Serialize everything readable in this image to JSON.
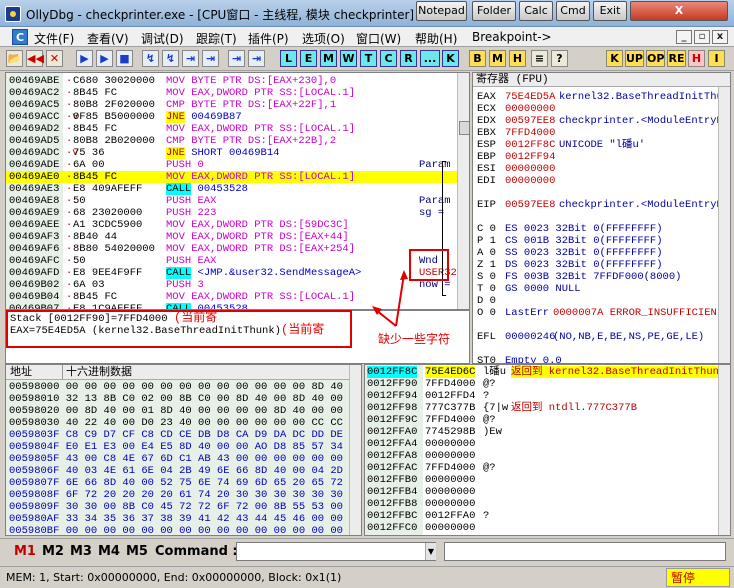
{
  "titlebar": {
    "title": "OllyDbg - checkprinter.exe - [CPU窗口 - 主线程, 模块 checkprinter]",
    "buttons": [
      "Notepad",
      "Folder",
      "Calc",
      "Cmd",
      "Exit"
    ],
    "close": "X"
  },
  "menu": {
    "icon_label": "C",
    "items": [
      "文件(F)",
      "查看(V)",
      "调试(D)",
      "跟踪(T)",
      "插件(P)",
      "选项(O)",
      "窗口(W)",
      "帮助(H)",
      "Breakpoint->"
    ]
  },
  "toolbar": {
    "debug_buttons": [
      "▶",
      "▶",
      "■",
      "↯",
      "↯",
      "⇥",
      "⇥",
      "⇥",
      "⇥"
    ],
    "window_letters": [
      "L",
      "E",
      "M",
      "W",
      "T",
      "C",
      "R",
      "...",
      "K"
    ],
    "extra_letters": [
      "B",
      "M",
      "H"
    ],
    "right_letters": [
      "K",
      "UP",
      "OP",
      "RE",
      "H",
      "I"
    ]
  },
  "disasm": {
    "rows": [
      {
        "addr": "00469ABE",
        "mark": "·",
        "bytes": "C680 30020000",
        "asm": [
          [
            "mov",
            "MOV BYTE PTR DS:[EAX+230],0"
          ]
        ],
        "cmt": ""
      },
      {
        "addr": "00469AC2",
        "mark": "·",
        "bytes": "8B45 FC",
        "asm": [
          [
            "mov",
            "MOV EAX,DWORD PTR SS:[LOCAL.1]"
          ]
        ],
        "cmt": ""
      },
      {
        "addr": "00469AC5",
        "mark": "·",
        "bytes": "80B8 2F020000",
        "asm": [
          [
            "cmp",
            "CMP BYTE PTR DS:[EAX+22F],1"
          ]
        ],
        "cmt": ""
      },
      {
        "addr": "00469ACC",
        "mark": "·v",
        "bytes": "0F85 B5000000",
        "asm": [
          [
            "jmp",
            "JNE"
          ],
          [
            "arg",
            " 00469B87"
          ]
        ],
        "cmt": ""
      },
      {
        "addr": "00469AD2",
        "mark": "·",
        "bytes": "8B45 FC",
        "asm": [
          [
            "mov",
            "MOV EAX,DWORD PTR SS:[LOCAL.1]"
          ]
        ],
        "cmt": ""
      },
      {
        "addr": "00469AD5",
        "mark": "·",
        "bytes": "80B8 2B020000",
        "asm": [
          [
            "cmp",
            "CMP BYTE PTR DS:[EAX+22B],2"
          ]
        ],
        "cmt": ""
      },
      {
        "addr": "00469ADC",
        "mark": "·v",
        "bytes": "75 36",
        "asm": [
          [
            "jmp",
            "JNE"
          ],
          [
            "arg",
            " SHORT 00469B14"
          ]
        ],
        "cmt": ""
      },
      {
        "addr": "00469ADE",
        "mark": "·",
        "bytes": "6A 00",
        "asm": [
          [
            "push",
            "PUSH 0"
          ]
        ],
        "cmt": "Param"
      },
      {
        "addr": "00469AE0",
        "mark": "·",
        "bytes": "8B45 FC",
        "asm": [
          [
            "mov",
            "MOV EAX,DWORD PTR SS:[LOCAL.1]"
          ]
        ],
        "cmt": "",
        "sel": true
      },
      {
        "addr": "00469AE3",
        "mark": "·",
        "bytes": "E8 409AFEFF",
        "asm": [
          [
            "call",
            "CALL"
          ],
          [
            "arg",
            " 00453528"
          ]
        ],
        "cmt": ""
      },
      {
        "addr": "00469AE8",
        "mark": "·",
        "bytes": "50",
        "asm": [
          [
            "push",
            "PUSH EAX"
          ]
        ],
        "cmt": "Param"
      },
      {
        "addr": "00469AE9",
        "mark": "·",
        "bytes": "68 23020000",
        "asm": [
          [
            "push",
            "PUSH 223"
          ]
        ],
        "cmt": "sg ="
      },
      {
        "addr": "00469AEE",
        "mark": "·",
        "bytes": "A1 3CDC5900",
        "asm": [
          [
            "mov",
            "MOV EAX,DWORD PTR DS:[59DC3C]"
          ]
        ],
        "cmt": ""
      },
      {
        "addr": "00469AF3",
        "mark": "·",
        "bytes": "8B40 44",
        "asm": [
          [
            "mov",
            "MOV EAX,DWORD PTR DS:[EAX+44]"
          ]
        ],
        "cmt": ""
      },
      {
        "addr": "00469AF6",
        "mark": "·",
        "bytes": "8B80 54020000",
        "asm": [
          [
            "mov",
            "MOV EAX,DWORD PTR DS:[EAX+254]"
          ]
        ],
        "cmt": ""
      },
      {
        "addr": "00469AFC",
        "mark": "·",
        "bytes": "50",
        "asm": [
          [
            "push",
            "PUSH EAX"
          ]
        ],
        "cmt": "Wnd"
      },
      {
        "addr": "00469AFD",
        "mark": "·",
        "bytes": "E8 9EE4F9FF",
        "asm": [
          [
            "call",
            "CALL"
          ],
          [
            "arg",
            " <JMP.&user32.SendMessageA>"
          ]
        ],
        "cmt": "USER32"
      },
      {
        "addr": "00469B02",
        "mark": "·",
        "bytes": "6A 03",
        "asm": [
          [
            "push",
            "PUSH 3"
          ]
        ],
        "cmt": "now ="
      },
      {
        "addr": "00469B04",
        "mark": "·",
        "bytes": "8B45 FC",
        "asm": [
          [
            "mov",
            "MOV EAX,DWORD PTR SS:[LOCAL.1]"
          ]
        ],
        "cmt": ""
      },
      {
        "addr": "00469B07",
        "mark": "·",
        "bytes": "E8 1C9AFEFF",
        "asm": [
          [
            "call",
            "CALL"
          ],
          [
            "arg",
            " 00453528"
          ]
        ],
        "cmt": ""
      }
    ]
  },
  "info": {
    "line1": "Stack [0012FF90]=7FFD4000",
    "line2": "EAX=75E4ED5A (kernel32.BaseThreadInitThunk)",
    "anno_current": "(当前寄",
    "anno_current2": "(当前寄"
  },
  "regs": {
    "header": "寄存器 (FPU)",
    "rows": [
      {
        "n": "EAX",
        "v": "75E4ED5A",
        "c": "red",
        "d": "kernel32.BaseThreadInitThun"
      },
      {
        "n": "ECX",
        "v": "00000000",
        "c": "red",
        "d": ""
      },
      {
        "n": "EDX",
        "v": "00597EE8",
        "c": "red",
        "d": "checkprinter.<ModuleEntryP"
      },
      {
        "n": "EBX",
        "v": "7FFD4000",
        "c": "red",
        "d": ""
      },
      {
        "n": "ESP",
        "v": "0012FF8C",
        "c": "red",
        "d": "UNICODE \"l磻u'"
      },
      {
        "n": "EBP",
        "v": "0012FF94",
        "c": "red",
        "d": ""
      },
      {
        "n": "ESI",
        "v": "00000000",
        "c": "red",
        "d": ""
      },
      {
        "n": "EDI",
        "v": "00000000",
        "c": "red",
        "d": ""
      },
      {
        "n": "",
        "v": "",
        "c": "",
        "d": ""
      },
      {
        "n": "EIP",
        "v": "00597EE8",
        "c": "red",
        "d": "checkprinter.<ModuleEntryP"
      },
      {
        "n": "",
        "v": "",
        "c": "",
        "d": ""
      },
      {
        "n": "C 0",
        "v": "ES 0023 32Bit 0(FFFFFFFF)",
        "c": "blue",
        "d": ""
      },
      {
        "n": "P 1",
        "v": "CS 001B 32Bit 0(FFFFFFFF)",
        "c": "blue",
        "d": ""
      },
      {
        "n": "A 0",
        "v": "SS 0023 32Bit 0(FFFFFFFF)",
        "c": "blue",
        "d": ""
      },
      {
        "n": "Z 1",
        "v": "DS 0023 32Bit 0(FFFFFFFF)",
        "c": "blue",
        "d": ""
      },
      {
        "n": "S 0",
        "v": "FS 003B 32Bit 7FFDF000(8000)",
        "c": "blue",
        "d": ""
      },
      {
        "n": "T 0",
        "v": "GS 0000 NULL",
        "c": "blue",
        "d": ""
      },
      {
        "n": "D 0",
        "v": "",
        "c": "",
        "d": ""
      },
      {
        "n": "O 0",
        "v": "LastErr",
        "c": "blue",
        "d": "0000007A ERROR_INSUFFICIEN"
      },
      {
        "n": "",
        "v": "",
        "c": "",
        "d": ""
      },
      {
        "n": "EFL",
        "v": "00000246",
        "c": "blue",
        "d": "(NO,NB,E,BE,NS,PE,GE,LE)"
      },
      {
        "n": "",
        "v": "",
        "c": "",
        "d": ""
      },
      {
        "n": "ST0",
        "v": "Empty 0.0",
        "c": "blue",
        "d": ""
      },
      {
        "n": "ST1",
        "v": "Empty 0.0",
        "c": "blue",
        "d": ""
      },
      {
        "n": "ST2",
        "v": "Empty 0.0",
        "c": "blue",
        "d": ""
      }
    ]
  },
  "dump": {
    "col_addr": "地址",
    "col_hex": "十六进制数据",
    "rows": [
      "00598000 00 00 00 00 00 00 00 00 00 00 00 00 00 8D 40 00",
      "00598010 32 13 8B C0 02 00 8B C0 00 8D 40 00 8D 40 00",
      "00598020 00 8D 40 00 01 8D 40 00 00 00 00 8D 40 00 00",
      "00598030 40 22 40 00 D0 23 40 00 00 00 00 00 00 CC CC",
      "0059803F C8 C9 D7 CF C8 CD CE DB D8 CA D9 DA DC DD DE DF",
      "0059804F E0 E1 E3 00 E4 E5 8D 40 00 00 AO D8 85 57 34 76",
      "0059805F 43 00 C8 4E 67 6D C1 AB 43 00 00 00 00 00 00 00",
      "0059806F 40 03 4E 61 6E 04 2B 49 6E 66 8D 40 00 04 2D 49",
      "0059807F 6E 66 8D 40 00 52 75 6E 74 69 6D 65 20 65 72 72",
      "0059808F 6F 72 20 20 20 20 61 74 20 30 30 30 30 30 30 30",
      "0059809F 30 30 00 8B C0 45 72 72 6F 72 00 8B 55 53 00 00",
      "005980AF 33 34 35 36 37 38 39 41 42 43 44 45 46 00 00 00",
      "005980BF 00 00 00 00 00 00 00 00 00 00 00 00 00 00 00 00"
    ]
  },
  "stack": {
    "rows": [
      {
        "a": "0012FF8C",
        "v": "75E4ED6C",
        "t": "l磻u",
        "c": "返回到 kernel32.BaseThreadInitThun",
        "sel": true
      },
      {
        "a": "0012FF90",
        "v": "7FFD4000",
        "t": "@?",
        "c": ""
      },
      {
        "a": "0012FF94",
        "v": "0012FFD4",
        "t": "?",
        "c": ""
      },
      {
        "a": "0012FF98",
        "v": "777C377B",
        "t": "{7|w",
        "c": "返回到 ntdll.777C377B"
      },
      {
        "a": "0012FF9C",
        "v": "7FFD4000",
        "t": "@?",
        "c": ""
      },
      {
        "a": "0012FFA0",
        "v": "7745298B",
        "t": ")Ew",
        "c": ""
      },
      {
        "a": "0012FFA4",
        "v": "00000000",
        "t": "",
        "c": ""
      },
      {
        "a": "0012FFA8",
        "v": "00000000",
        "t": "",
        "c": ""
      },
      {
        "a": "0012FFAC",
        "v": "7FFD4000",
        "t": "@?",
        "c": ""
      },
      {
        "a": "0012FFB0",
        "v": "00000000",
        "t": "",
        "c": ""
      },
      {
        "a": "0012FFB4",
        "v": "00000000",
        "t": "",
        "c": ""
      },
      {
        "a": "0012FFB8",
        "v": "00000000",
        "t": "",
        "c": ""
      },
      {
        "a": "0012FFBC",
        "v": "0012FFA0",
        "t": "?",
        "c": ""
      },
      {
        "a": "0012FFC0",
        "v": "00000000",
        "t": "",
        "c": ""
      }
    ]
  },
  "cmdbar": {
    "buttons": [
      "M1",
      "M2",
      "M3",
      "M4",
      "M5"
    ],
    "command_label": "Command :",
    "command_value": ""
  },
  "status": {
    "text": "MEM: 1, Start: 0x00000000, End: 0x00000000, Block: 0x1(1)",
    "state": "暂停"
  },
  "annotations": {
    "missing_chars": "缺少一些字符",
    "color": "#e00000"
  }
}
